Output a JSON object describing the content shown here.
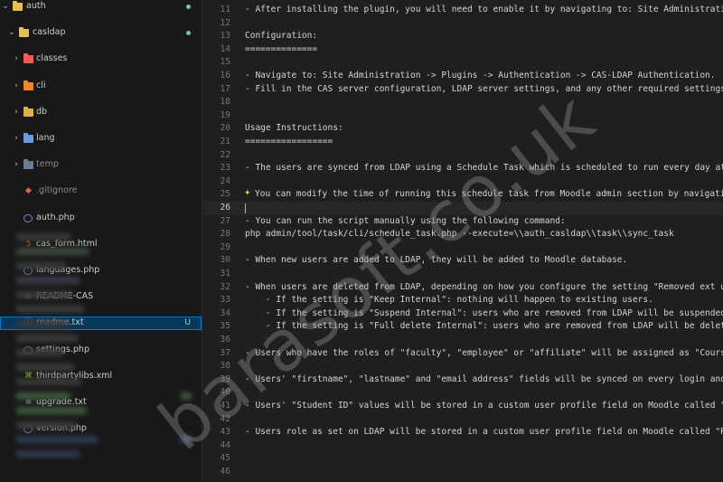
{
  "explorer": {
    "root": {
      "label": "auth"
    },
    "folder": {
      "label": "casldap"
    },
    "items": [
      {
        "label": "classes",
        "kind": "folder",
        "color": "#f25c54"
      },
      {
        "label": "cli",
        "kind": "folder",
        "color": "#e88a2d"
      },
      {
        "label": "db",
        "kind": "folder",
        "color": "#d8b24a"
      },
      {
        "label": "lang",
        "kind": "folder",
        "color": "#6f9ad9"
      },
      {
        "label": "temp",
        "kind": "folder",
        "color": "#6d7c8c"
      },
      {
        "label": ".gitignore",
        "kind": "file"
      },
      {
        "label": "auth.php",
        "kind": "file"
      },
      {
        "label": "cas_form.html",
        "kind": "file"
      },
      {
        "label": "languages.php",
        "kind": "file"
      },
      {
        "label": "README-CAS",
        "kind": "file"
      },
      {
        "label": "readme.txt",
        "kind": "file",
        "badge": "U"
      },
      {
        "label": "settings.php",
        "kind": "file"
      },
      {
        "label": "thirdpartylibs.xml",
        "kind": "file"
      },
      {
        "label": "upgrade.txt",
        "kind": "file"
      },
      {
        "label": "version.php",
        "kind": "file"
      }
    ]
  },
  "editor": {
    "lines": [
      {
        "n": "11",
        "text": "- After installing the plugin, you will need to enable it by navigating to: Site Administratio"
      },
      {
        "n": "12",
        "text": ""
      },
      {
        "n": "13",
        "text": "Configuration:"
      },
      {
        "n": "14",
        "text": "=============="
      },
      {
        "n": "15",
        "text": ""
      },
      {
        "n": "16",
        "text": "- Navigate to: Site Administration -> Plugins -> Authentication -> CAS-LDAP Authentication."
      },
      {
        "n": "17",
        "text": "- Fill in the CAS server configuration, LDAP server settings, and any other required settings"
      },
      {
        "n": "18",
        "text": ""
      },
      {
        "n": "19",
        "text": ""
      },
      {
        "n": "20",
        "text": "Usage Instructions:"
      },
      {
        "n": "21",
        "text": "================="
      },
      {
        "n": "22",
        "text": ""
      },
      {
        "n": "23",
        "text": "- The users are synced from LDAP using a Schedule Task which is scheduled to run every day at"
      },
      {
        "n": "24",
        "text": ""
      },
      {
        "n": "25",
        "text": "You can modify the time of running this schedule task from Moodle admin section by navigatin"
      },
      {
        "n": "26",
        "text": ""
      },
      {
        "n": "27",
        "text": "- You can run the script manually using the following command:"
      },
      {
        "n": "28",
        "text": "php admin/tool/task/cli/schedule_task.php --execute=\\\\auth_casldap\\\\task\\\\sync_task"
      },
      {
        "n": "29",
        "text": ""
      },
      {
        "n": "30",
        "text": "- When new users are added to LDAP, they will be added to Moodle database."
      },
      {
        "n": "31",
        "text": ""
      },
      {
        "n": "32",
        "text": "- When users are deleted from LDAP, depending on how you configure the setting \"Removed ext us"
      },
      {
        "n": "33",
        "text": "    - If the setting is \"Keep Internal\": nothing will happen to existing users."
      },
      {
        "n": "34",
        "text": "    - If the setting is \"Suspend Internal\": users who are removed from LDAP will be suspended"
      },
      {
        "n": "35",
        "text": "    - If the setting is \"Full delete Internal\": users who are removed from LDAP will be delete"
      },
      {
        "n": "36",
        "text": ""
      },
      {
        "n": "37",
        "text": "- Users who have the roles of \"faculty\", \"employee\" or \"affiliate\" will be assigned as \"Course"
      },
      {
        "n": "38",
        "text": ""
      },
      {
        "n": "39",
        "text": "- Users' \"firstname\", \"lastname\" and \"email address\" fields will be synced on every login and"
      },
      {
        "n": "40",
        "text": ""
      },
      {
        "n": "41",
        "text": "- Users' \"Student ID\" values will be stored in a custom user profile field on Moodle called \"I"
      },
      {
        "n": "42",
        "text": ""
      },
      {
        "n": "43",
        "text": "- Users role as set on LDAP will be stored in a custom user profile field on Moodle called \"Ro"
      },
      {
        "n": "44",
        "text": ""
      },
      {
        "n": "45",
        "text": ""
      },
      {
        "n": "46",
        "text": ""
      }
    ],
    "active_line": "26"
  },
  "watermark": "barasoft.co.uk",
  "colors": {
    "selection": "#04395e",
    "untracked_badge": "#e2c08d",
    "status_dot": "#73c991"
  }
}
